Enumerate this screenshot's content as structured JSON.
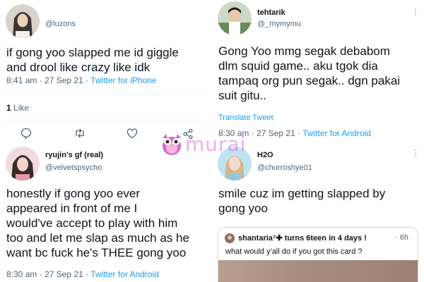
{
  "tweet_a": {
    "handle": "@luzons",
    "text_lines": [
      "if gong yoo slapped me id giggle",
      "and drool like crazy like idk"
    ],
    "time": "8:41 am · 27 Sep 21 · ",
    "source": "Twitter for iPhone",
    "likes_count": "1",
    "likes_label": " Like"
  },
  "tweet_b": {
    "display_name": "tehtarik",
    "handle": "@_mymymu",
    "text_lines": [
      "Gong Yoo mmg segak debabom",
      "dlm squid game.. aku tgok dia",
      "tampaq org pun segak.. dgn pakai",
      "suit gitu.."
    ],
    "translate_label": "Translate Tweet",
    "time": "8:30 am · 27 Sep 21 · ",
    "source": "Twitter for Android"
  },
  "tweet_c": {
    "display_name": "ryujin's gf (real)",
    "handle": "@velvetspsycho",
    "text_lines": [
      "honestly if gong yoo ever",
      "appeared in front of me I",
      "would've accept to play with him",
      "too and let me slap as much as he",
      "want bc fuck he's THEE gong yoo"
    ],
    "time": "8:30 am · 27 Sep 21 · ",
    "source": "Twitter for Android"
  },
  "tweet_d": {
    "display_name": "H2O",
    "handle": "@churroshye01",
    "text_lines": [
      "smile cuz im getting slapped by",
      "gong yoo"
    ],
    "quote": {
      "display_name": "shantaria⁷✚ turns 6teen in 4 days !",
      "time_ago": "· 6h",
      "text": "what would y'all do if you got this card ?"
    }
  },
  "watermark": {
    "text": "murai"
  },
  "icons": {
    "reply": "reply-icon",
    "retweet": "retweet-icon",
    "like": "like-icon",
    "share": "share-icon",
    "more": "more-options-icon"
  },
  "colors": {
    "link": "#1d9bf0",
    "muted": "#536471",
    "watermark": "#e36bd3"
  }
}
